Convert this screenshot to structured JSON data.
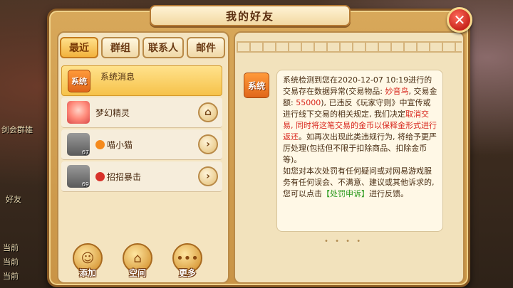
{
  "background": {
    "left_labels": [
      "剑会群雄",
      "好友",
      "当前",
      "当前",
      "当前"
    ]
  },
  "dialog": {
    "title": "我的好友",
    "close_label": "✕"
  },
  "tabs": [
    {
      "label": "最近",
      "active": true
    },
    {
      "label": "群组",
      "active": false
    },
    {
      "label": "联系人",
      "active": false
    },
    {
      "label": "邮件",
      "active": false
    }
  ],
  "contacts": [
    {
      "name": "系统消息",
      "avatar_text": "系统",
      "active": true
    },
    {
      "name": "梦幻精灵",
      "level": "",
      "action_icon": "home-icon"
    },
    {
      "name": "喵小猫",
      "level": "67",
      "action_icon": "arrow-right-icon"
    },
    {
      "name": "招招暴击",
      "level": "69",
      "action_icon": "arrow-right-icon"
    }
  ],
  "bottom_buttons": [
    {
      "label": "添加",
      "icon": "add-friend-icon"
    },
    {
      "label": "空间",
      "icon": "house-icon"
    },
    {
      "label": "更多",
      "icon": "more-icon"
    }
  ],
  "message": {
    "sender_avatar_text": "系统",
    "segments": {
      "p1_a": "系统检测到您在2020-12-07 10:19进行的交易存在数据异常(交易物品: ",
      "p1_item": "妙音鸟",
      "p1_b": ", 交易金额: ",
      "p1_amount": "55000",
      "p1_c": "), 已违反《玩家守则》中宣传或进行线下交易的相关规定, 我们决定",
      "p1_action": "取消交易, 同时将这笔交易的金币以保释金形式进行返还",
      "p1_d": "。如再次出现此类违规行为, 将给予更严厉处理(包括但不限于扣除商品、扣除金币等)。",
      "p2_a": "如您对本次处罚有任何疑问或对网易游戏服务有任何误会、不满意、建议或其他诉求的, 您可以点击",
      "p2_link": "【处罚申诉】",
      "p2_b": "进行反馈。"
    }
  },
  "colors": {
    "accent_red": "#d8261c",
    "link_green": "#2a9a1c",
    "active_tab": "#f2b23c"
  }
}
